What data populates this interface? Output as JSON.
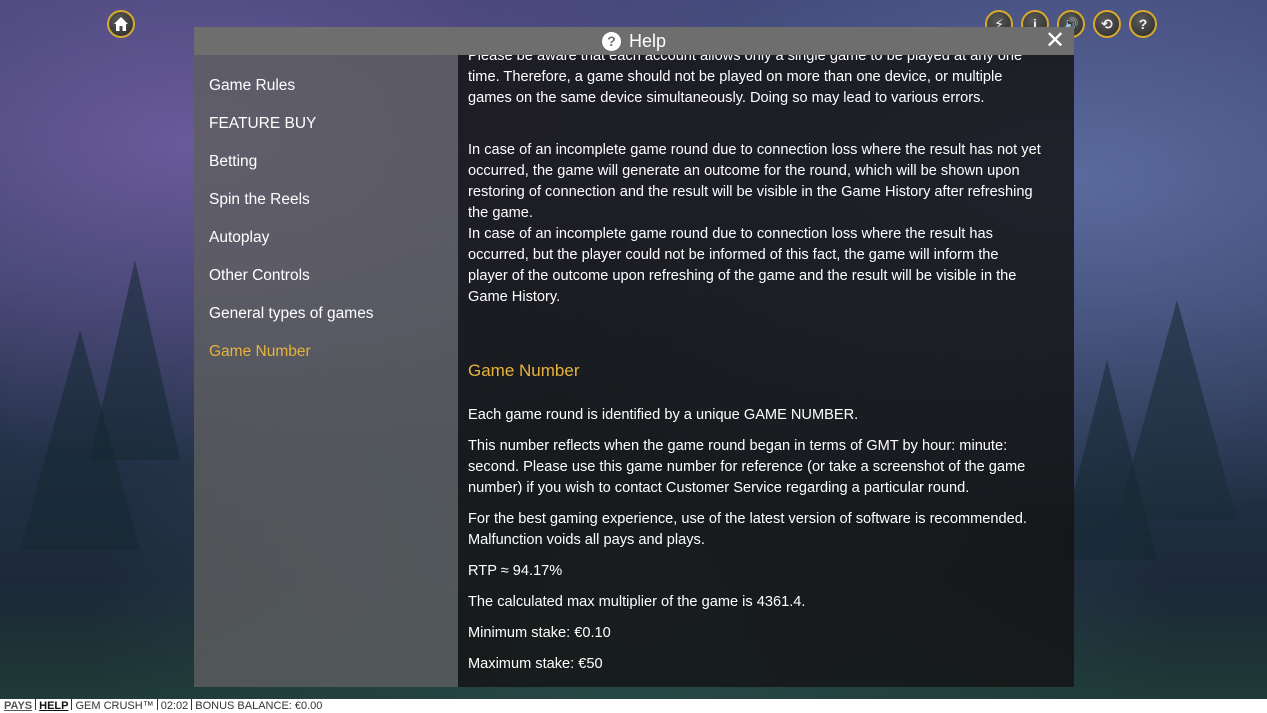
{
  "header": {
    "title": "Help",
    "close_glyph": "✕",
    "help_glyph": "?"
  },
  "top_buttons": [
    {
      "name": "home-icon"
    },
    {
      "name": "lightning-icon",
      "glyph": "⚡"
    },
    {
      "name": "info-icon",
      "glyph": "i"
    },
    {
      "name": "sound-icon",
      "glyph": "🔊"
    },
    {
      "name": "history-icon",
      "glyph": "⟲"
    },
    {
      "name": "help-icon",
      "glyph": "?"
    }
  ],
  "sidebar": {
    "items": [
      {
        "label": "Game Rules",
        "active": false
      },
      {
        "label": "FEATURE BUY",
        "active": false
      },
      {
        "label": "Betting",
        "active": false
      },
      {
        "label": "Spin the Reels",
        "active": false
      },
      {
        "label": "Autoplay",
        "active": false
      },
      {
        "label": "Other Controls",
        "active": false
      },
      {
        "label": "General types of games",
        "active": false
      },
      {
        "label": "Game Number",
        "active": true
      }
    ]
  },
  "content": {
    "intro_lines": [
      "Please be aware that each account allows only a single game to be played at any one",
      "time. Therefore, a game should not be played on more than one device, or multiple",
      "games on the same device simultaneously. Doing so may lead to various errors."
    ],
    "incomplete_1": [
      "In case of an incomplete game round due to connection loss where the result has not yet",
      "occurred, the game will generate an outcome for the round, which will be shown upon",
      "restoring of connection and the result will be visible in the Game History after refreshing",
      "the game."
    ],
    "incomplete_2": [
      "In case of an incomplete game round due to connection loss where the result has",
      "occurred, but the player could not be informed of this fact, the game will inform the",
      "player of the outcome upon refreshing of the game and the result will be visible in the",
      "Game History."
    ],
    "section_title": "Game Number",
    "game_number_1": "Each game round is identified by a unique GAME NUMBER.",
    "game_number_2": [
      "This number reflects when the game round began in terms of GMT by hour: minute:",
      "second. Please use this game number for reference (or take a screenshot of the game",
      "number) if you wish to contact Customer Service regarding a particular round."
    ],
    "software": [
      "For the best gaming experience, use of the latest version of software is recommended.",
      "Malfunction voids all pays and plays."
    ],
    "rtp": "RTP ≈ 94.17%",
    "max_multiplier": "The calculated max multiplier of the game is 4361.4.",
    "min_stake": "Minimum stake: €0.10",
    "max_stake": "Maximum stake: €50"
  },
  "statusbar": {
    "pays": "PAYS",
    "help": "HELP",
    "game_name": "GEM CRUSH™",
    "time": "02:02",
    "bonus_balance": "BONUS BALANCE: €0.00"
  },
  "colors": {
    "accent": "#e8b33c",
    "header_bg": "#6e6e6e",
    "content_bg": "#141414"
  }
}
